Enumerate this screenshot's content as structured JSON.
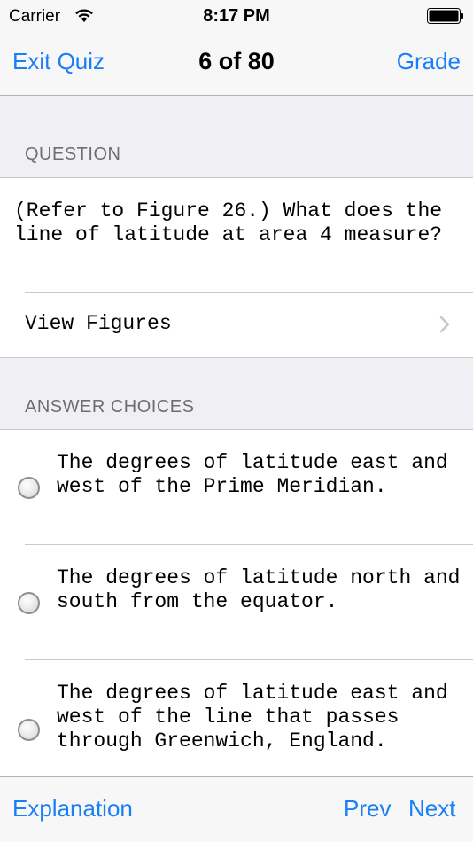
{
  "status_bar": {
    "carrier": "Carrier",
    "time": "8:17 PM"
  },
  "nav": {
    "exit_label": "Exit Quiz",
    "title": "6 of 80",
    "grade_label": "Grade"
  },
  "question_section": {
    "header": "QUESTION",
    "text": "(Refer to Figure 26.) What does the line of latitude at area 4 measure?",
    "view_figures_label": "View Figures"
  },
  "answers_section": {
    "header": "ANSWER CHOICES",
    "choices": [
      {
        "text": "The degrees of latitude east and west of the Prime Meridian."
      },
      {
        "text": "The degrees of latitude north and south from the equator."
      },
      {
        "text": "The degrees of latitude east and west of the line that passes through Greenwich, England."
      }
    ]
  },
  "toolbar": {
    "explanation_label": "Explanation",
    "prev_label": "Prev",
    "next_label": "Next"
  },
  "colors": {
    "accent": "#1a7ef7",
    "background": "#efeff4",
    "bar": "#f7f7f7"
  }
}
